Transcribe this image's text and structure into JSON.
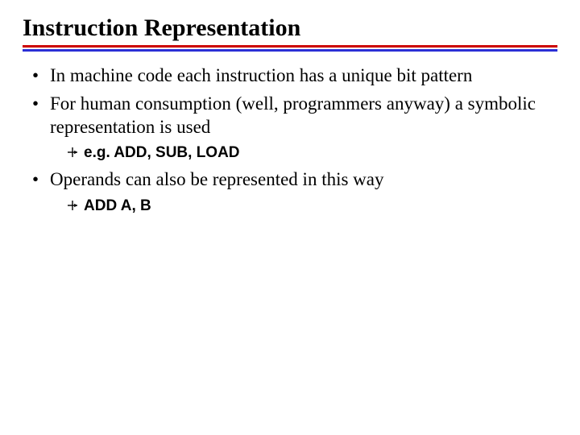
{
  "title": "Instruction Representation",
  "bullets": [
    {
      "text": "In machine code each instruction has a unique bit pattern",
      "sub": []
    },
    {
      "text": "For human consumption (well, programmers anyway) a symbolic representation is used",
      "sub": [
        {
          "text": "e.g. ADD, SUB, LOAD"
        }
      ]
    },
    {
      "text": "Operands can also be represented in this way",
      "sub": [
        {
          "text": "ADD A, B"
        }
      ]
    }
  ]
}
